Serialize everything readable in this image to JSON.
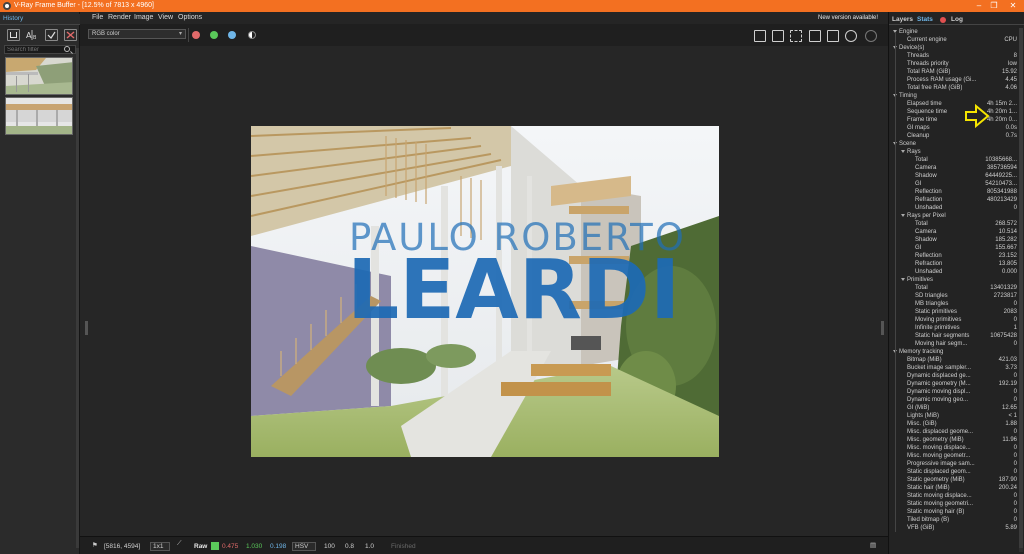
{
  "window": {
    "title": "V-Ray Frame Buffer - [12.5% of 7813 x 4960]",
    "min": "–",
    "max": "❐",
    "close": "✕"
  },
  "menu": [
    "File",
    "Render",
    "Image",
    "View",
    "Options"
  ],
  "new_version": "New version available!",
  "history": {
    "tab": "History",
    "search_placeholder": "Search filter"
  },
  "toolbar": {
    "channel": "RGB color",
    "dots": [
      "#e06a6a",
      "#5ac85a",
      "#6fb6e8",
      "#dddddd"
    ]
  },
  "watermark": {
    "line1": "PAULO ROBERTO",
    "line2": "LEARDI"
  },
  "status": {
    "coords": "[5816, 4594]",
    "zoom": "1x1",
    "raw": "Raw",
    "r": "0.475",
    "g": "1.030",
    "b": "0.198",
    "colorspace": "HSV",
    "v1": "100",
    "v2": "0.8",
    "v3": "1.0",
    "state": "Finished"
  },
  "right_panel": {
    "tabs": {
      "layers": "Layers",
      "stats": "Stats",
      "log": "Log"
    },
    "rows": [
      {
        "d": 0,
        "exp": true,
        "label": "Engine",
        "value": ""
      },
      {
        "d": 1,
        "label": "Current engine",
        "value": "CPU"
      },
      {
        "d": 0,
        "exp": true,
        "label": "Device(s)",
        "value": ""
      },
      {
        "d": 1,
        "label": "Threads",
        "value": "8"
      },
      {
        "d": 1,
        "label": "Threads priority",
        "value": "low"
      },
      {
        "d": 1,
        "label": "Total RAM (GiB)",
        "value": "15.92"
      },
      {
        "d": 1,
        "label": "Process RAM usage (Gi...",
        "value": "4.45"
      },
      {
        "d": 1,
        "label": "Total free RAM (GiB)",
        "value": "4.06"
      },
      {
        "d": 0,
        "exp": true,
        "label": "Timing",
        "value": ""
      },
      {
        "d": 1,
        "label": "Elapsed time",
        "value": "4h 15m 2..."
      },
      {
        "d": 1,
        "label": "Sequence time",
        "value": "4h 20m 1..."
      },
      {
        "d": 1,
        "label": "Frame time",
        "value": "4h 20m 0..."
      },
      {
        "d": 1,
        "label": "GI maps",
        "value": "0.0s"
      },
      {
        "d": 1,
        "label": "Cleanup",
        "value": "0.7s"
      },
      {
        "d": 0,
        "exp": true,
        "label": "Scene",
        "value": ""
      },
      {
        "d": 1,
        "exp": true,
        "label": "Rays",
        "value": ""
      },
      {
        "d": 2,
        "label": "Total",
        "value": "10385668..."
      },
      {
        "d": 2,
        "label": "Camera",
        "value": "385736594"
      },
      {
        "d": 2,
        "label": "Shadow",
        "value": "64449225..."
      },
      {
        "d": 2,
        "label": "GI",
        "value": "54210473..."
      },
      {
        "d": 2,
        "label": "Reflection",
        "value": "805341988"
      },
      {
        "d": 2,
        "label": "Refraction",
        "value": "480213429"
      },
      {
        "d": 2,
        "label": "Unshaded",
        "value": "0"
      },
      {
        "d": 1,
        "exp": true,
        "label": "Rays per Pixel",
        "value": ""
      },
      {
        "d": 2,
        "label": "Total",
        "value": "268.572"
      },
      {
        "d": 2,
        "label": "Camera",
        "value": "10.514"
      },
      {
        "d": 2,
        "label": "Shadow",
        "value": "185.282"
      },
      {
        "d": 2,
        "label": "GI",
        "value": "155.667"
      },
      {
        "d": 2,
        "label": "Reflection",
        "value": "23.152"
      },
      {
        "d": 2,
        "label": "Refraction",
        "value": "13.805"
      },
      {
        "d": 2,
        "label": "Unshaded",
        "value": "0.000"
      },
      {
        "d": 1,
        "exp": true,
        "label": "Primitives",
        "value": ""
      },
      {
        "d": 2,
        "label": "Total",
        "value": "13401329"
      },
      {
        "d": 2,
        "label": "SD triangles",
        "value": "2723817"
      },
      {
        "d": 2,
        "label": "MB triangles",
        "value": "0"
      },
      {
        "d": 2,
        "label": "Static primitives",
        "value": "2083"
      },
      {
        "d": 2,
        "label": "Moving primitives",
        "value": "0"
      },
      {
        "d": 2,
        "label": "Infinite primitives",
        "value": "1"
      },
      {
        "d": 2,
        "label": "Static hair segments",
        "value": "10675428"
      },
      {
        "d": 2,
        "label": "Moving hair segm...",
        "value": "0"
      },
      {
        "d": 0,
        "exp": true,
        "label": "Memory tracking",
        "value": ""
      },
      {
        "d": 1,
        "label": "Bitmap (MiB)",
        "value": "421.03"
      },
      {
        "d": 1,
        "label": "Bucket image sampler...",
        "value": "3.73"
      },
      {
        "d": 1,
        "label": "Dynamic displaced ge...",
        "value": "0"
      },
      {
        "d": 1,
        "label": "Dynamic geometry (M...",
        "value": "192.19"
      },
      {
        "d": 1,
        "label": "Dynamic moving displ...",
        "value": "0"
      },
      {
        "d": 1,
        "label": "Dynamic moving geo...",
        "value": "0"
      },
      {
        "d": 1,
        "label": "GI (MiB)",
        "value": "12.65"
      },
      {
        "d": 1,
        "label": "Lights (MiB)",
        "value": "< 1"
      },
      {
        "d": 1,
        "label": "Misc. (GiB)",
        "value": "1.88"
      },
      {
        "d": 1,
        "label": "Misc. displaced geome...",
        "value": "0"
      },
      {
        "d": 1,
        "label": "Misc. geometry (MiB)",
        "value": "11.96"
      },
      {
        "d": 1,
        "label": "Misc. moving displace...",
        "value": "0"
      },
      {
        "d": 1,
        "label": "Misc. moving geometr...",
        "value": "0"
      },
      {
        "d": 1,
        "label": "Progressive image sam...",
        "value": "0"
      },
      {
        "d": 1,
        "label": "Static displaced geom...",
        "value": "0"
      },
      {
        "d": 1,
        "label": "Static geometry (MiB)",
        "value": "187.90"
      },
      {
        "d": 1,
        "label": "Static hair (MiB)",
        "value": "200.24"
      },
      {
        "d": 1,
        "label": "Static moving displace...",
        "value": "0"
      },
      {
        "d": 1,
        "label": "Static moving geometri...",
        "value": "0"
      },
      {
        "d": 1,
        "label": "Static moving hair (B)",
        "value": "0"
      },
      {
        "d": 1,
        "label": "Tiled bitmap (B)",
        "value": "0"
      },
      {
        "d": 1,
        "label": "VFB (GiB)",
        "value": "5.89"
      }
    ]
  }
}
